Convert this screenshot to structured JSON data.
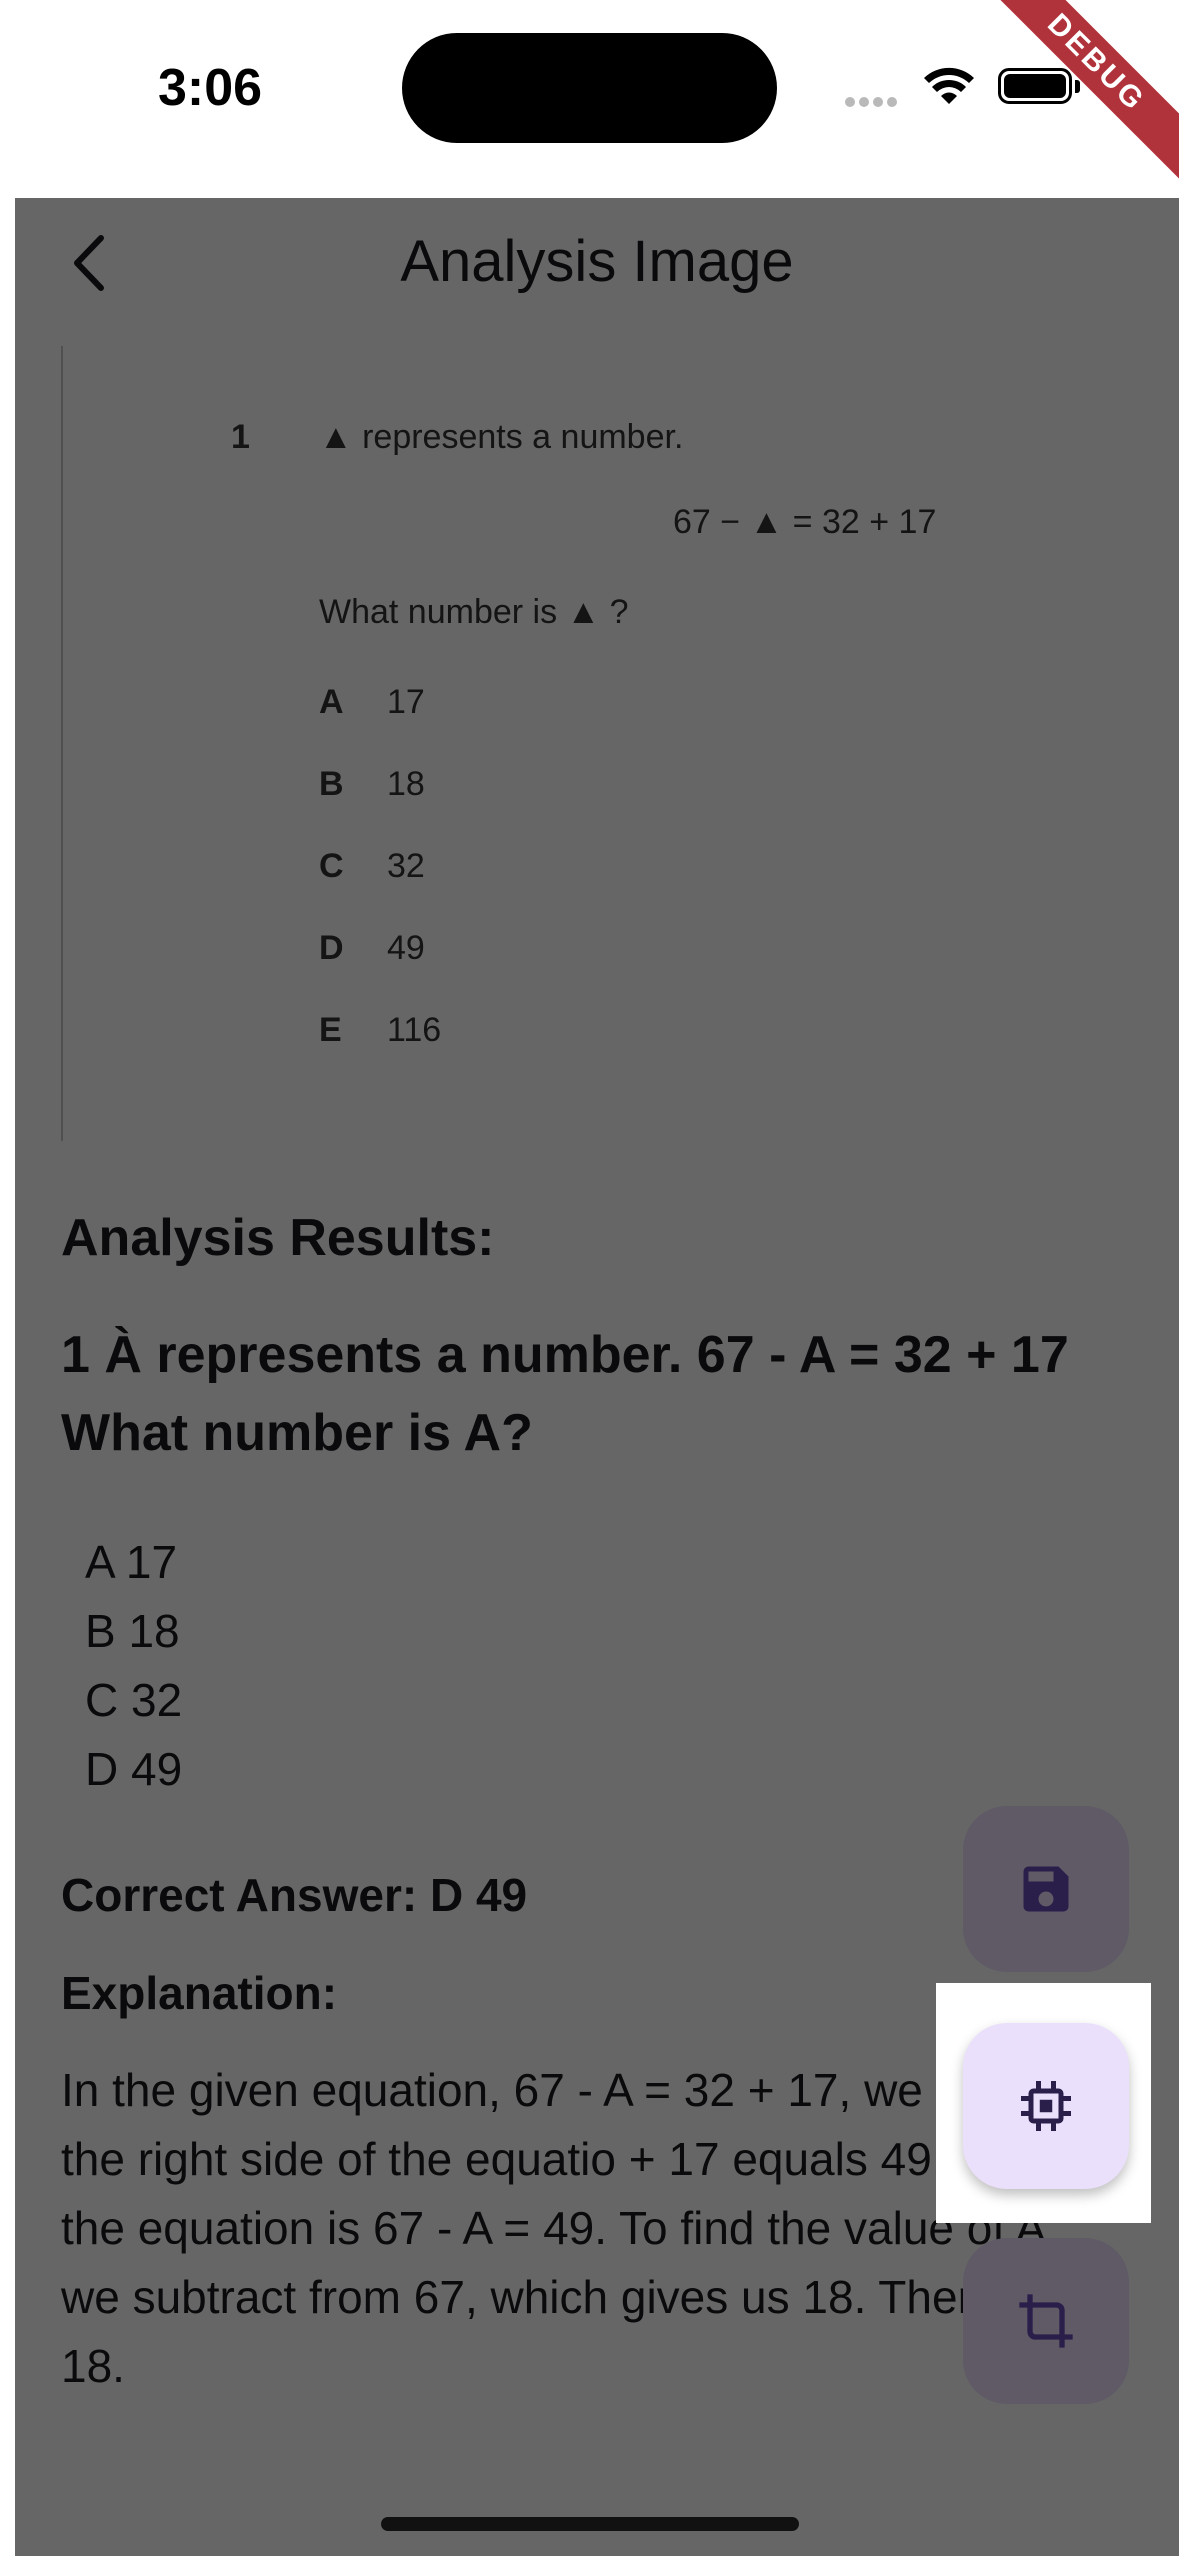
{
  "status_bar": {
    "time": "3:06",
    "debug_label": "DEBUG"
  },
  "app_bar": {
    "title": "Analysis Image"
  },
  "image": {
    "number": "1",
    "line1": "▲ represents a number.",
    "equation": "67 − ▲ = 32 + 17",
    "question": "What number is ▲ ?",
    "options": [
      {
        "letter": "A",
        "value": "17"
      },
      {
        "letter": "B",
        "value": "18"
      },
      {
        "letter": "C",
        "value": "32"
      },
      {
        "letter": "D",
        "value": "49"
      },
      {
        "letter": "E",
        "value": "116"
      }
    ]
  },
  "results": {
    "heading": "Analysis Results:",
    "question": "1 À represents a number. 67 - A = 32 + 17 What number is A?",
    "options": [
      "A 17",
      "B 18",
      "C 32",
      "D 49"
    ],
    "correct_answer": "Correct Answer: D 49",
    "explanation_heading": "Explanation:",
    "explanation": "In the given equation, 67 - A = 32 + 17, we simplify the right side of the equatio + 17 equals 49. Now the equation is 67 - A = 49. To find the value of A, we subtract from 67, which gives us 18. Therefore, 18."
  },
  "fabs": {
    "save_icon": "save-icon",
    "process_icon": "chip-icon",
    "crop_icon": "crop-icon"
  },
  "colors": {
    "fab_highlight": "#ebe0fc",
    "icon_dark": "#2a1f4a",
    "debug_ribbon": "#b0323a"
  }
}
